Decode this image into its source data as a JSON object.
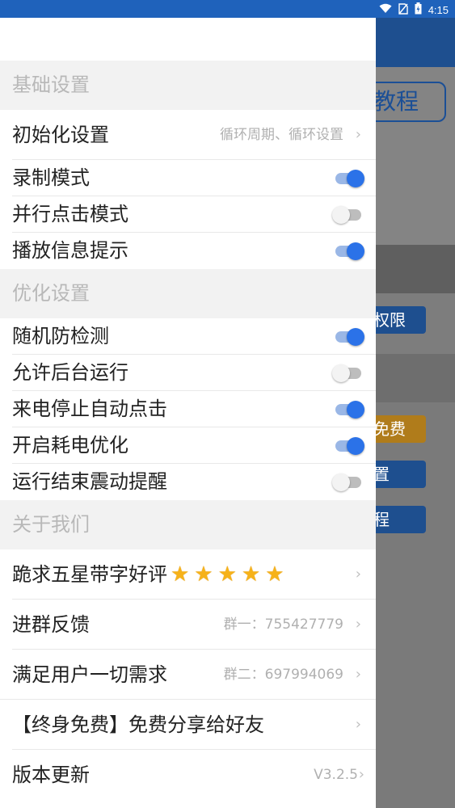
{
  "status": {
    "time": "4:15"
  },
  "background": {
    "tutorial_label": "教程",
    "permission_label": "权限",
    "free_label": "免费",
    "setup_label": "置",
    "course_label": "程"
  },
  "sections": {
    "basic": "基础设置",
    "optimize": "优化设置",
    "about": "关于我们"
  },
  "basic": {
    "init_label": "初始化设置",
    "init_value": "循环周期、循环设置",
    "record_label": "录制模式",
    "record_on": true,
    "parallel_label": "并行点击模式",
    "parallel_on": false,
    "playback_label": "播放信息提示",
    "playback_on": true
  },
  "optimize": {
    "random_label": "随机防检测",
    "random_on": true,
    "background_label": "允许后台运行",
    "background_on": false,
    "call_label": "来电停止自动点击",
    "call_on": true,
    "power_label": "开启耗电优化",
    "power_on": true,
    "vibrate_label": "运行结束震动提醒",
    "vibrate_on": false
  },
  "about": {
    "review_label": "跪求五星带字好评",
    "review_stars": "★★★★★",
    "group_feedback_label": "进群反馈",
    "group1": "群一：755427779",
    "needs_label": "满足用户一切需求",
    "group2": "群二：697994069",
    "share_label": "【终身免费】免费分享给好友",
    "update_label": "版本更新",
    "version": "V3.2.5"
  },
  "icons": {
    "chevron": "›"
  },
  "colors": {
    "accent": "#2b72e8",
    "toggle_track_on": "#9ab7e6",
    "toggle_off": "#bdbdbd"
  }
}
